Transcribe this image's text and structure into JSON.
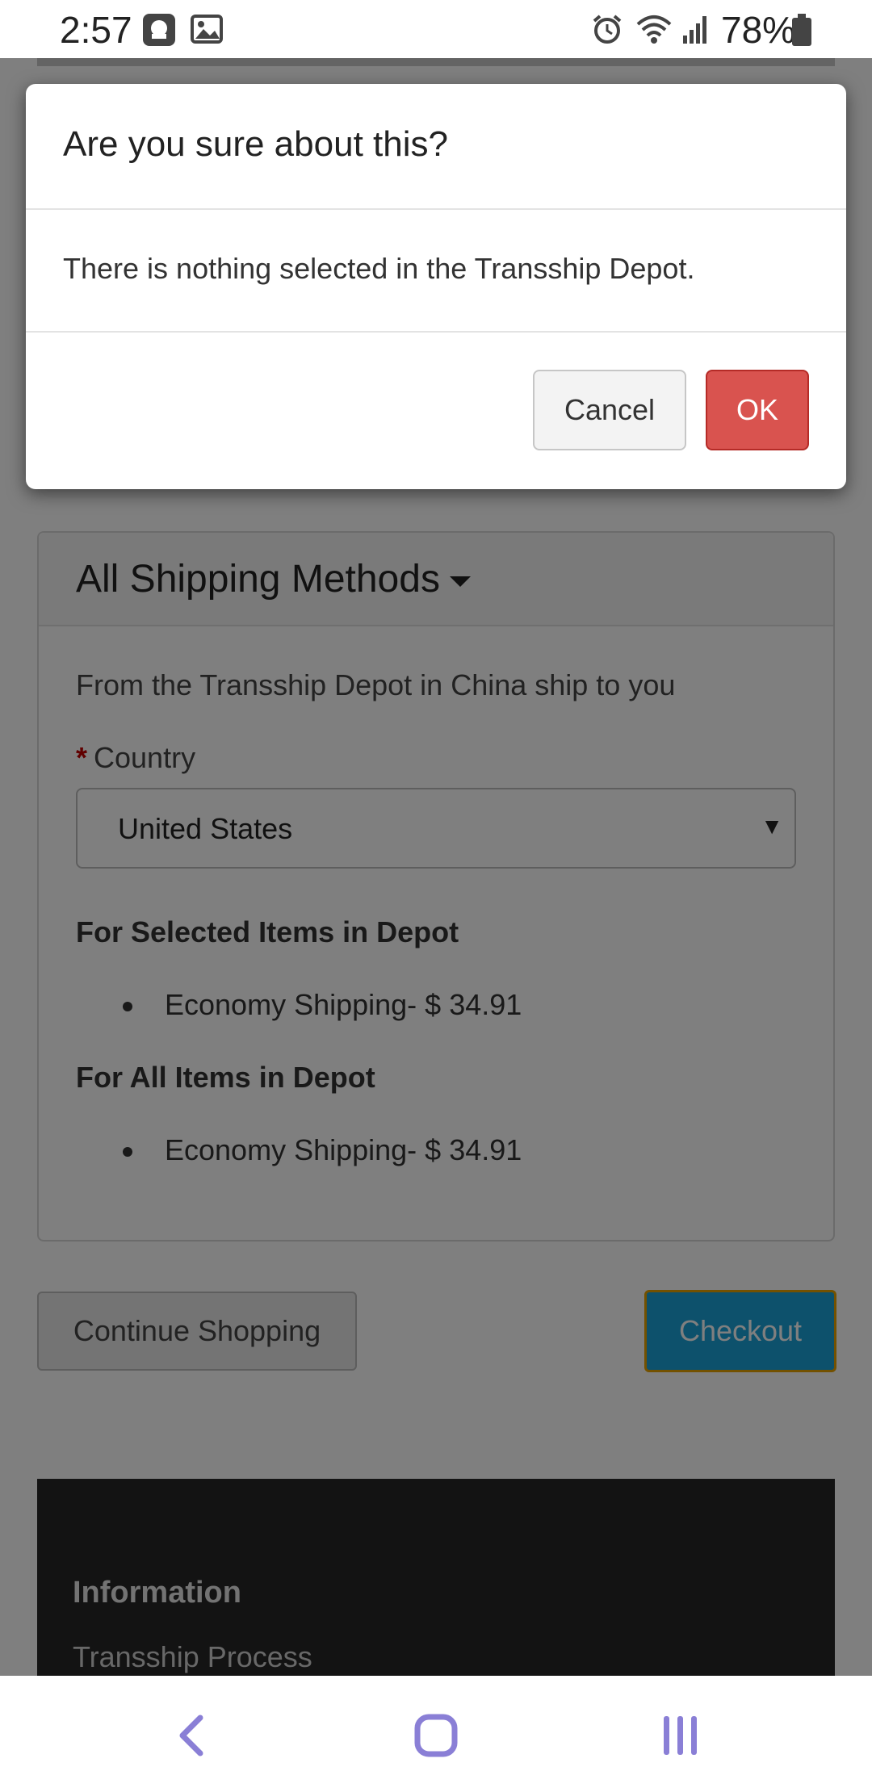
{
  "status_bar": {
    "time": "2:57",
    "battery_percent": "78%",
    "icons": [
      "chat-bubble-icon",
      "gallery-icon",
      "alarm-icon",
      "wifi-icon",
      "signal-icon",
      "battery-icon"
    ]
  },
  "dialog": {
    "title": "Are you sure about this?",
    "message": "There is nothing selected in the Transship Depot.",
    "cancel_label": "Cancel",
    "ok_label": "OK"
  },
  "shipping": {
    "title": "All Shipping Methods",
    "intro": "From the Transship Depot in China ship to you",
    "country_label": "Country",
    "required_marker": "*",
    "country_value": "United States",
    "selected_heading": "For Selected Items in Depot",
    "selected_items": [
      "Economy Shipping- $ 34.91"
    ],
    "all_heading": "For All Items in Depot",
    "all_items": [
      "Economy Shipping- $ 34.91"
    ]
  },
  "actions": {
    "continue_label": "Continue Shopping",
    "checkout_label": "Checkout"
  },
  "footer": {
    "heading": "Information",
    "link": "Transship Process"
  },
  "nav_bar": {
    "icons": [
      "back-icon",
      "home-icon",
      "recent-apps-icon"
    ]
  },
  "colors": {
    "ok_red": "#d9534f",
    "checkout_blue": "#1aa3d9",
    "checkout_border": "#e6a300",
    "nav_icon": "#8a7fd6"
  }
}
